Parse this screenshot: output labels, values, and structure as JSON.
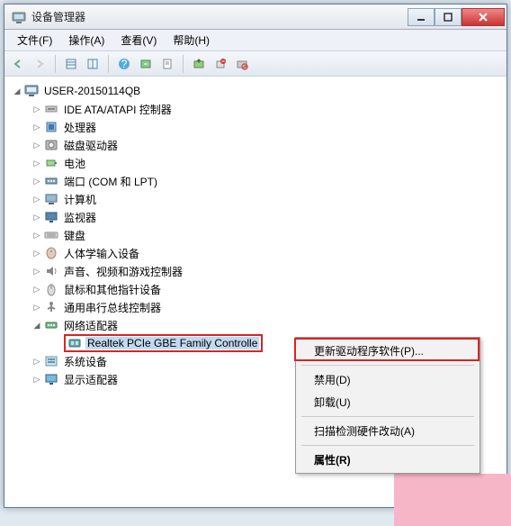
{
  "window": {
    "title": "设备管理器"
  },
  "menubar": {
    "file": "文件(F)",
    "action": "操作(A)",
    "view": "查看(V)",
    "help": "帮助(H)"
  },
  "tree": {
    "root": "USER-20150114QB",
    "items": [
      {
        "label": "IDE ATA/ATAPI 控制器",
        "icon": "ide"
      },
      {
        "label": "处理器",
        "icon": "cpu"
      },
      {
        "label": "磁盘驱动器",
        "icon": "disk"
      },
      {
        "label": "电池",
        "icon": "battery"
      },
      {
        "label": "端口 (COM 和 LPT)",
        "icon": "port"
      },
      {
        "label": "计算机",
        "icon": "computer"
      },
      {
        "label": "监视器",
        "icon": "monitor"
      },
      {
        "label": "键盘",
        "icon": "keyboard"
      },
      {
        "label": "人体学输入设备",
        "icon": "hid"
      },
      {
        "label": "声音、视频和游戏控制器",
        "icon": "sound"
      },
      {
        "label": "鼠标和其他指针设备",
        "icon": "mouse"
      },
      {
        "label": "通用串行总线控制器",
        "icon": "usb"
      }
    ],
    "network": {
      "label": "网络适配器",
      "child": "Realtek PCIe GBE Family Controlle"
    },
    "tail": [
      {
        "label": "系统设备",
        "icon": "system"
      },
      {
        "label": "显示适配器",
        "icon": "display"
      }
    ]
  },
  "context_menu": {
    "update": "更新驱动程序软件(P)...",
    "disable": "禁用(D)",
    "uninstall": "卸载(U)",
    "scan": "扫描检测硬件改动(A)",
    "properties": "属性(R)"
  },
  "colors": {
    "highlight_border": "#d22",
    "selection_bg": "#c2d8ef",
    "close_btn": "#c33"
  }
}
